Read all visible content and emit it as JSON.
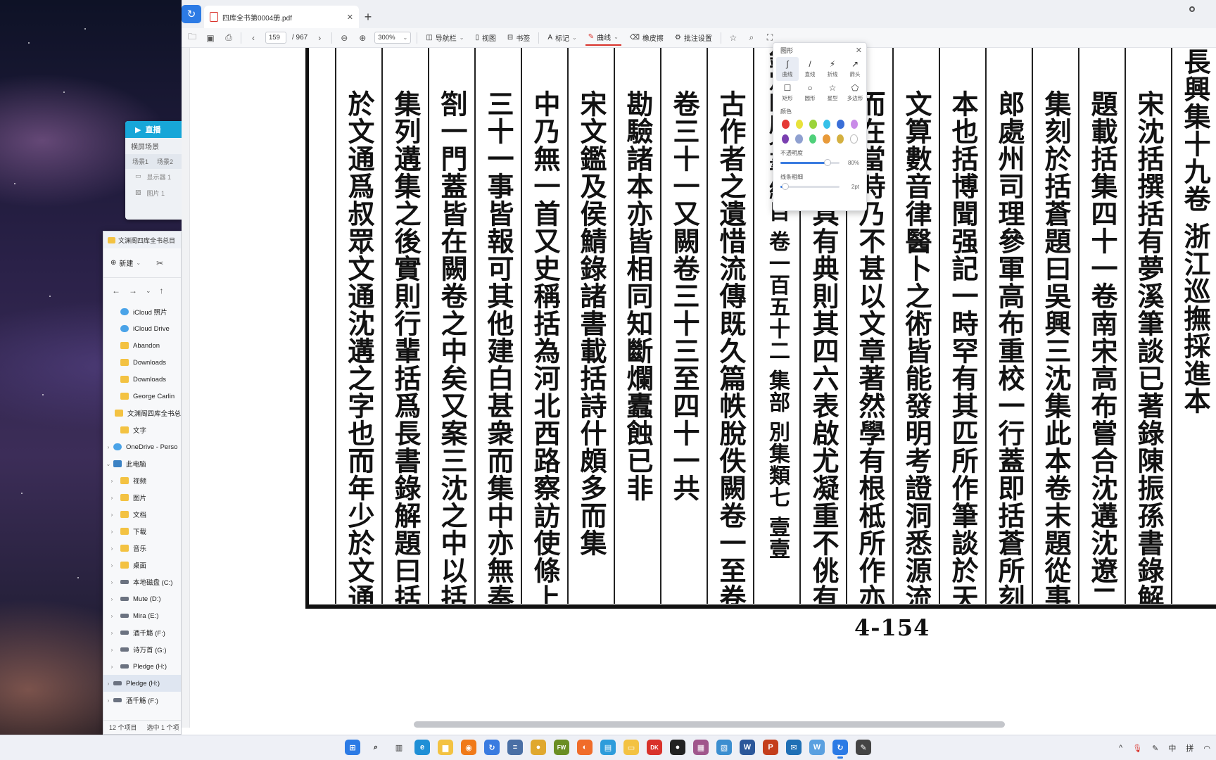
{
  "stream_panel": {
    "header": "直播",
    "scene": "横屏场景",
    "tabs": [
      "场景1",
      "场景2"
    ],
    "sources": [
      "显示器 1",
      "图片 1"
    ]
  },
  "explorer": {
    "title": "文渊阁四库全书总目",
    "new_label": "新建",
    "nav": [
      "←",
      "→",
      "⌄",
      "↑"
    ],
    "tree": [
      {
        "label": "iCloud 照片",
        "type": "cloud",
        "indent": 1
      },
      {
        "label": "iCloud Drive",
        "type": "cloud",
        "indent": 1
      },
      {
        "label": "Abandon",
        "type": "folder",
        "indent": 1
      },
      {
        "label": "Downloads",
        "type": "folder",
        "indent": 1
      },
      {
        "label": "Downloads",
        "type": "folder",
        "indent": 1
      },
      {
        "label": "George Carlin",
        "type": "folder",
        "indent": 1
      },
      {
        "label": "文渊阁四库全书总",
        "type": "folder",
        "indent": 1
      },
      {
        "label": "文字",
        "type": "folder",
        "indent": 1
      },
      {
        "label": "OneDrive - Perso",
        "type": "cloud",
        "indent": 0,
        "chevron": "›"
      },
      {
        "label": "此电脑",
        "type": "pc",
        "indent": 0,
        "chevron": "⌄"
      },
      {
        "label": "视频",
        "type": "folder",
        "indent": 1,
        "chevron": "›"
      },
      {
        "label": "图片",
        "type": "folder",
        "indent": 1,
        "chevron": "›"
      },
      {
        "label": "文档",
        "type": "folder",
        "indent": 1,
        "chevron": "›"
      },
      {
        "label": "下载",
        "type": "folder",
        "indent": 1,
        "chevron": "›"
      },
      {
        "label": "音乐",
        "type": "folder",
        "indent": 1,
        "chevron": "›"
      },
      {
        "label": "桌面",
        "type": "folder",
        "indent": 1,
        "chevron": "›"
      },
      {
        "label": "本地磁盘 (C:)",
        "type": "drive",
        "indent": 1,
        "chevron": "›"
      },
      {
        "label": "Mute (D:)",
        "type": "drive",
        "indent": 1,
        "chevron": "›"
      },
      {
        "label": "Mira (E:)",
        "type": "drive",
        "indent": 1,
        "chevron": "›"
      },
      {
        "label": "酒千觞 (F:)",
        "type": "drive",
        "indent": 1,
        "chevron": "›"
      },
      {
        "label": "诗万首 (G:)",
        "type": "drive",
        "indent": 1,
        "chevron": "›"
      },
      {
        "label": "Pledge (H:)",
        "type": "drive",
        "indent": 1,
        "chevron": "›"
      },
      {
        "label": "Pledge (H:)",
        "type": "drive",
        "indent": 0,
        "chevron": "›"
      },
      {
        "label": "酒千觞 (F:)",
        "type": "drive",
        "indent": 0,
        "chevron": "›"
      }
    ],
    "status_count": "12 个项目",
    "status_selected": "选中 1 个项"
  },
  "reader": {
    "tab_title": "四库全书第0004册.pdf",
    "new_tab": "+",
    "toolbar": {
      "page_current": "159",
      "page_total": "/ 967",
      "zoom": "300%",
      "nav_panel": "导航栏",
      "view": "视图",
      "bookmark": "书签",
      "markup": "标记",
      "curve": "曲线",
      "eraser": "橡皮擦",
      "annot_settings": "批注设置"
    },
    "page_number": "4-154"
  },
  "shape_popup": {
    "title": "图形",
    "shapes": [
      {
        "label": "曲线",
        "icon": "curve-icon",
        "glyph": "∫"
      },
      {
        "label": "直线",
        "icon": "line-icon",
        "glyph": "/"
      },
      {
        "label": "折线",
        "icon": "polyline-icon",
        "glyph": "⚡"
      },
      {
        "label": "箭头",
        "icon": "arrow-icon",
        "glyph": "↗"
      },
      {
        "label": "矩形",
        "icon": "rectangle-icon",
        "glyph": "☐"
      },
      {
        "label": "圆形",
        "icon": "circle-icon",
        "glyph": "○"
      },
      {
        "label": "星型",
        "icon": "star-icon",
        "glyph": "☆"
      },
      {
        "label": "多边形",
        "icon": "polygon-icon",
        "glyph": "⬠"
      }
    ],
    "color_label": "颜色",
    "colors": [
      "#e53935",
      "#e8e23a",
      "#9bd43a",
      "#36c0e8",
      "#3a6fd8",
      "#c98be8",
      "#7a3fb0",
      "#8fa0d0",
      "#4fd07a",
      "#e89a3a",
      "#d4b040",
      "#ffffff"
    ],
    "opacity_label": "不透明度",
    "opacity_value": "80%",
    "opacity_fraction": 0.8,
    "stroke_label": "线条粗细",
    "stroke_value": "2pt",
    "stroke_fraction": 0.08
  },
  "scan_columns": [
    "長興集十九卷 浙江巡撫採進本",
    "宋沈括撰括有夢溪筆談已著錄陳振孫書錄解",
    "題載括集四十一卷南宋高布嘗合沈遘沈遼二",
    "集刻於括蒼題曰吳興三沈集此本卷末題從事",
    "郎處州司理參軍高布重校一行蓋即括蒼所刻",
    "本也括博聞强記一時罕有其匹所作筆談於天",
    "文算數音律醫卜之術皆能發明考證洞悉源流",
    "而在當時乃不甚以文章著然學有根柢所作亦",
    "宏贍淹雅具有典則其四六表啟尤凝重不佻有",
    "欽定四庫全書總目 卷一百五十二 集部 別集類七 壹壹",
    "古作者之遺惜流傳既久篇帙脫佚闕卷一至卷",
    "卷三十一又闕卷三十三至四十一共",
    "勘驗諸本亦皆相同知斷爛蠹蝕已非",
    "宋文鑑及侯鯖錄諸書載括詩什頗多而集",
    "中乃無一首又史稱括為河北西路察訪使條上",
    "三十一事皆報可其他建白甚衆而集中亦無奏",
    "劄一門蓋皆在闕卷之中矣又案三沈之中以括",
    "集列遘集之後實則行輩括爲長書錄解題曰括",
    "於文通爲叔眾文通沈遘之字也而年少於文通世傳文通"
  ],
  "taskbar": {
    "icons": [
      "start-icon",
      "search-icon",
      "task-view-icon",
      "edge-icon",
      "file-explorer-icon",
      "everything-icon",
      "refresh-icon",
      "notepad-icon",
      "chrome-icon",
      "pdf-app-icon",
      "firefox-icon",
      "store-icon",
      "notes-icon",
      "dk-icon",
      "obs-icon",
      "photos-icon",
      "vm-icon",
      "word-icon",
      "powerpoint-icon",
      "mail-icon",
      "ime-icon",
      "browser-icon",
      "pen-icon"
    ],
    "tray": [
      "^",
      "中",
      "拼"
    ]
  }
}
